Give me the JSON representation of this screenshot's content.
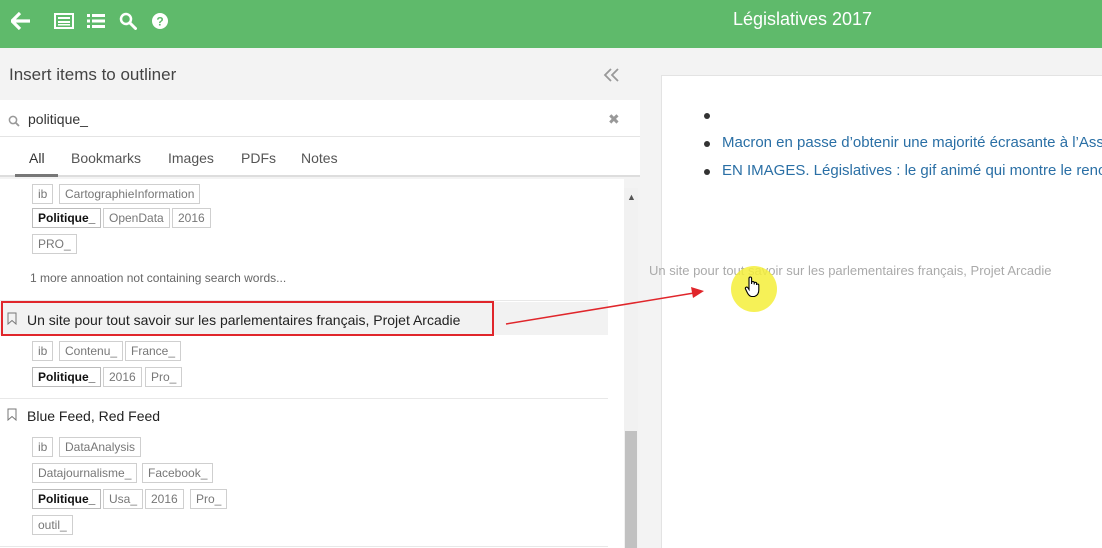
{
  "topbar": {
    "title": "Législatives 2017",
    "icons": [
      "back-arrow-icon",
      "card-list-icon",
      "list-icon",
      "search-icon",
      "help-icon"
    ]
  },
  "sidebar": {
    "title": "Insert items to outliner",
    "search": {
      "value": "politique_",
      "placeholder": ""
    },
    "tabs": [
      "All",
      "Bookmarks",
      "Images",
      "PDFs",
      "Notes"
    ],
    "active_tab": "All",
    "prev_item": {
      "tag_rows": [
        [
          {
            "text": "ib"
          },
          {
            "text": "CartographieInformation"
          }
        ],
        [
          {
            "text": "Politique_",
            "bold": true
          },
          {
            "text": "OpenData"
          },
          {
            "text": "2016"
          }
        ],
        [
          {
            "text": "PRO_"
          }
        ]
      ],
      "more_text": "1 more annoation not containing search words..."
    },
    "items": [
      {
        "title": "Un site pour tout savoir sur les parlementaires français, Projet Arcadie",
        "tag_rows": [
          [
            {
              "text": "ib"
            },
            {
              "text": "Contenu_"
            },
            {
              "text": "France_"
            }
          ],
          [
            {
              "text": "Politique_",
              "bold": true
            },
            {
              "text": "2016"
            },
            {
              "text": "Pro_"
            }
          ]
        ]
      },
      {
        "title": "Blue Feed, Red Feed",
        "tag_rows": [
          [
            {
              "text": "ib"
            },
            {
              "text": "DataAnalysis"
            }
          ],
          [
            {
              "text": "Datajournalisme_"
            },
            {
              "text": "Facebook_"
            }
          ],
          [
            {
              "text": "Politique_",
              "bold": true
            },
            {
              "text": "Usa_"
            },
            {
              "text": "2016"
            },
            {
              "text": "Pro_"
            }
          ],
          [
            {
              "text": "outil_"
            }
          ]
        ]
      }
    ]
  },
  "outline": {
    "bullets": [
      "",
      "Macron en passe d’obtenir une majorité écrasante à l’Assemblée",
      "EN IMAGES. Législatives : le gif animé qui montre le renouvellement"
    ],
    "drag_ghost": "Un site pour tout savoir sur les parlementaires français, Projet Arcadie"
  },
  "colors": {
    "topbar": "#5fba6b",
    "highlight": "#e0262b",
    "link": "#2a6fa5",
    "cursor": "#f5ef3a"
  }
}
